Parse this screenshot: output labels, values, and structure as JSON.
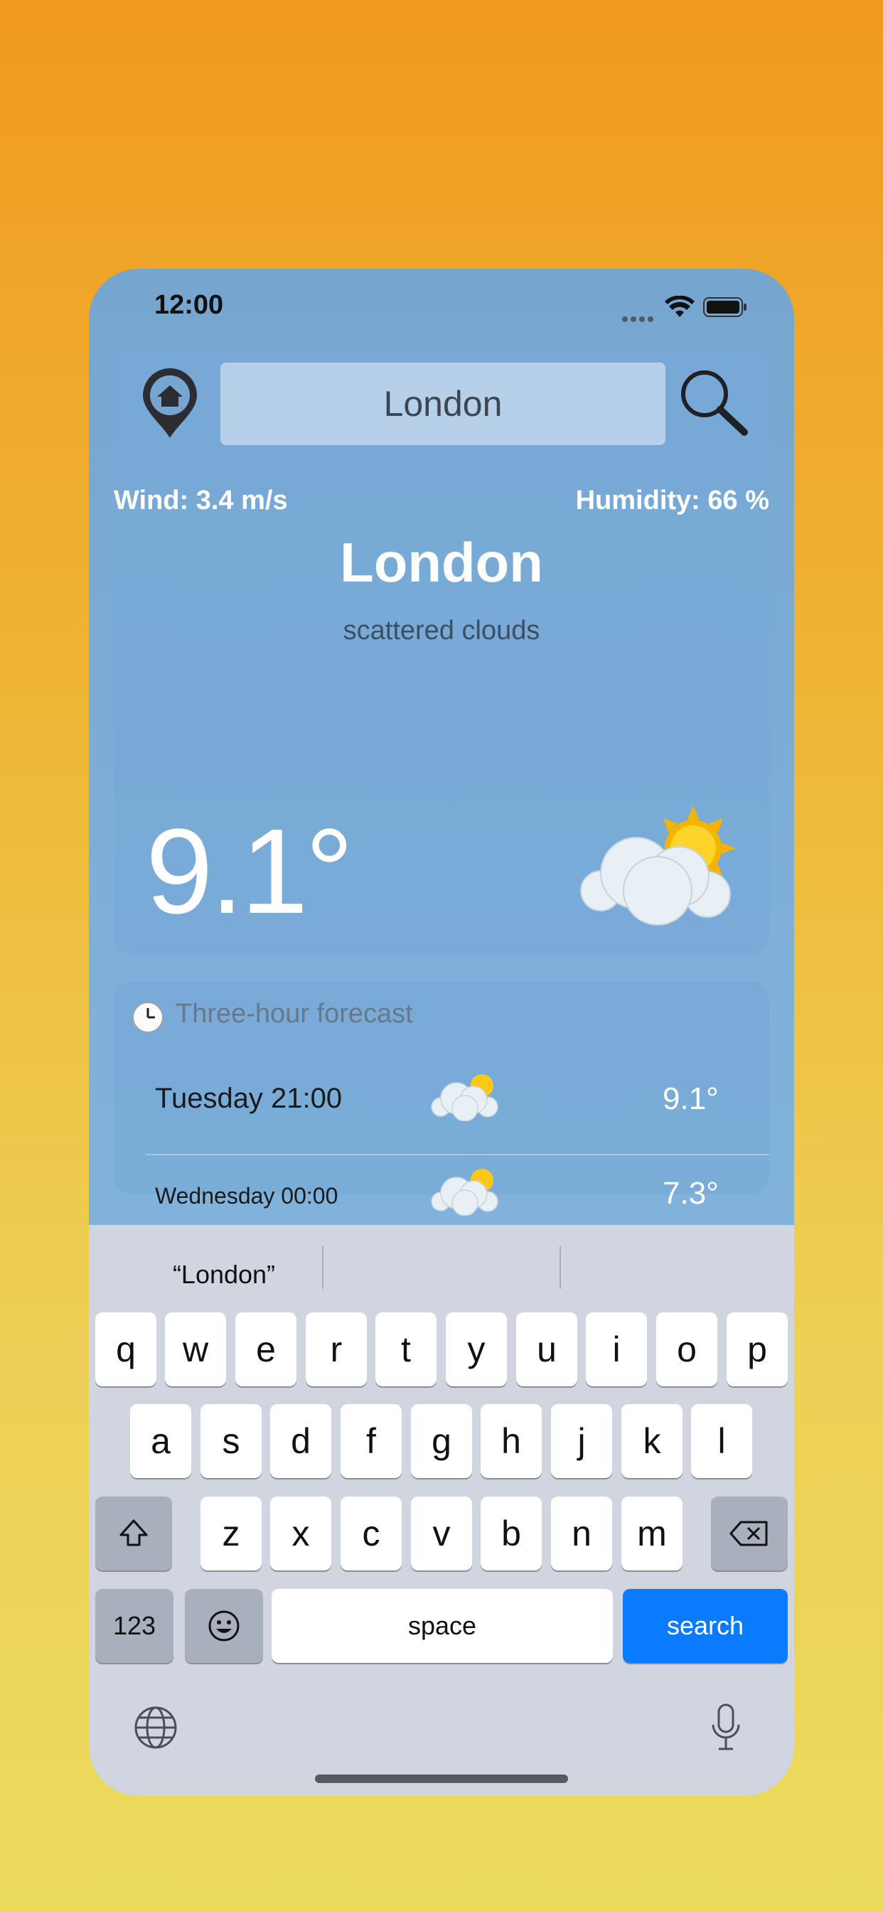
{
  "status": {
    "time": "12:00"
  },
  "search": {
    "value": "London"
  },
  "weather": {
    "wind": "Wind: 3.4 m/s",
    "humidity": "Humidity: 66 %",
    "city": "London",
    "condition": "scattered clouds",
    "temperature": "9.1°",
    "icon": "sun-behind-cloud-icon"
  },
  "forecast": {
    "title": "Three-hour forecast",
    "rows": [
      {
        "day": "Tuesday 21:00",
        "temp": "9.1°",
        "icon": "sun-behind-cloud-icon"
      },
      {
        "day": "Wednesday 00:00",
        "temp": "7.3°",
        "icon": "sun-behind-cloud-icon"
      }
    ]
  },
  "keyboard": {
    "suggestion": "“London”",
    "row1": [
      "q",
      "w",
      "e",
      "r",
      "t",
      "y",
      "u",
      "i",
      "o",
      "p"
    ],
    "row2": [
      "a",
      "s",
      "d",
      "f",
      "g",
      "h",
      "j",
      "k",
      "l"
    ],
    "row3": [
      "z",
      "x",
      "c",
      "v",
      "b",
      "n",
      "m"
    ],
    "numbers": "123",
    "space": "space",
    "action": "search"
  },
  "colors": {
    "background_top": "#F09A1E",
    "background_bottom": "#ECDA5C",
    "card": "#78AAD7",
    "search_key": "#0A7AFF"
  }
}
